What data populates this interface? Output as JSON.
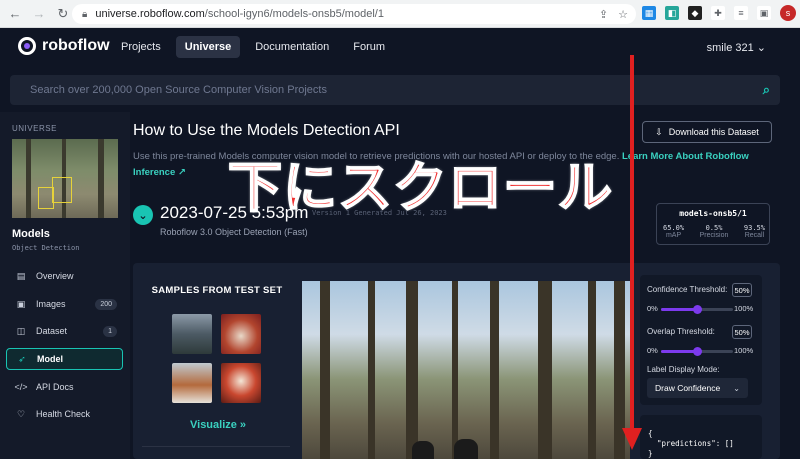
{
  "browser": {
    "url_host": "universe.roboflow.com",
    "url_path": "/school-igyn6/models-onsb5/model/1",
    "profile_initial": "s"
  },
  "nav": {
    "brand": "roboflow",
    "links": [
      {
        "label": "Projects"
      },
      {
        "label": "Universe"
      },
      {
        "label": "Documentation"
      },
      {
        "label": "Forum"
      }
    ],
    "active_link": "Universe",
    "user": "smile 321"
  },
  "search": {
    "placeholder": "Search over 200,000 Open Source Computer Vision Projects"
  },
  "sidebar": {
    "section": "UNIVERSE",
    "project_title": "Models",
    "project_type": "Object Detection",
    "items": [
      {
        "label": "Overview",
        "icon": "overview-icon"
      },
      {
        "label": "Images",
        "icon": "images-icon",
        "count": "200"
      },
      {
        "label": "Dataset",
        "icon": "dataset-icon",
        "count": "1"
      },
      {
        "label": "Model",
        "icon": "model-icon",
        "active": true
      },
      {
        "label": "API Docs",
        "icon": "api-docs-icon"
      },
      {
        "label": "Health Check",
        "icon": "health-check-icon"
      }
    ]
  },
  "main": {
    "title": "How to Use the Models Detection API",
    "download_label": "Download this Dataset",
    "description": "Use this pre-trained Models computer vision model to retrieve predictions with our hosted API or deploy to the edge.",
    "learn_more": "Learn More About Roboflow Inference ↗",
    "version_date": "2023-07-25 5:53pm",
    "version_generated": "Version 1 Generated Jul 26, 2023",
    "version_sub": "Roboflow 3.0 Object Detection (Fast)",
    "metrics": {
      "model_id": "models-onsb5/1",
      "items": [
        {
          "value": "65.0%",
          "label": "mAP"
        },
        {
          "value": "0.5%",
          "label": "Precision"
        },
        {
          "value": "93.5%",
          "label": "Recall"
        }
      ]
    }
  },
  "samples": {
    "title": "SAMPLES FROM TEST SET",
    "visualize_label": "Visualize »"
  },
  "controls": {
    "confidence_label": "Confidence Threshold:",
    "confidence_value": "50%",
    "confidence_level": 0.5,
    "overlap_label": "Overlap Threshold:",
    "overlap_value": "50%",
    "overlap_level": 0.5,
    "min": "0%",
    "max": "100%",
    "mode_label": "Label Display Mode:",
    "mode_value": "Draw Confidence"
  },
  "json_output": "{\n  \"predictions\": []\n}",
  "annotation": {
    "text": "下にスクロール",
    "color": "#e02020"
  }
}
